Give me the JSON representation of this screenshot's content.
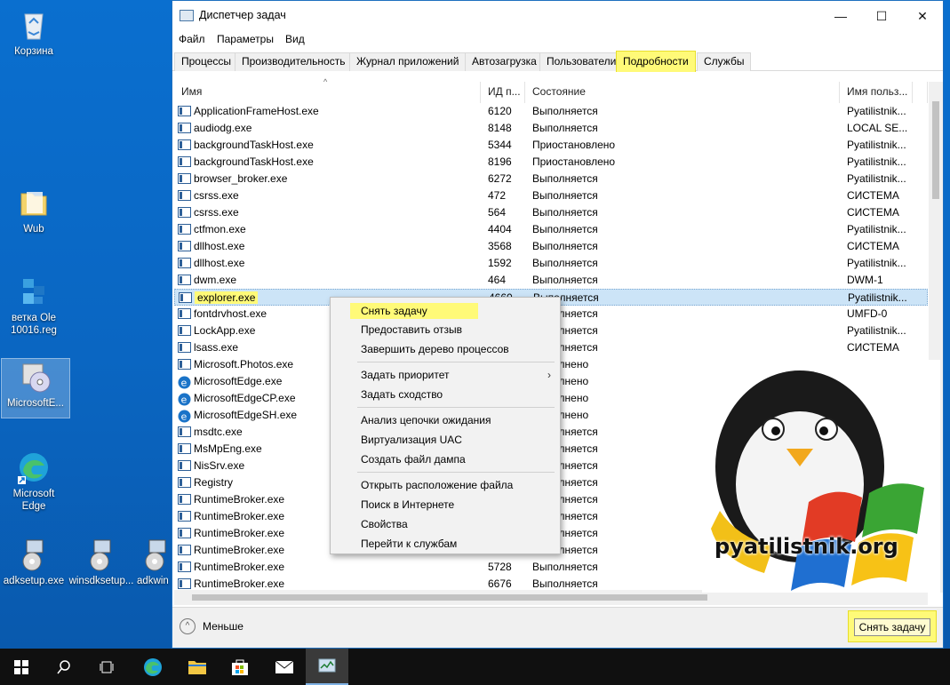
{
  "desktop": {
    "icons": [
      {
        "label": "Корзина"
      },
      {
        "label": "Wub"
      },
      {
        "label": "ветка Ole 10016.reg"
      },
      {
        "label": "MicrosoftE..."
      },
      {
        "label": "Microsoft Edge"
      },
      {
        "label": "adksetup.exe"
      },
      {
        "label": "winsdksetup..."
      },
      {
        "label": "adkwin"
      }
    ]
  },
  "window": {
    "title": "Диспетчер задач",
    "menu": [
      "Файл",
      "Параметры",
      "Вид"
    ],
    "tabs": [
      "Процессы",
      "Производительность",
      "Журнал приложений",
      "Автозагрузка",
      "Пользователи",
      "Подробности",
      "Службы"
    ],
    "active_tab": "Подробности",
    "columns": [
      "Имя",
      "ИД п...",
      "Состояние",
      "Имя польз..."
    ],
    "rows": [
      {
        "name": "ApplicationFrameHost.exe",
        "pid": "6120",
        "state": "Выполняется",
        "user": "Pyatilistnik..."
      },
      {
        "name": "audiodg.exe",
        "pid": "8148",
        "state": "Выполняется",
        "user": "LOCAL SE..."
      },
      {
        "name": "backgroundTaskHost.exe",
        "pid": "5344",
        "state": "Приостановлено",
        "user": "Pyatilistnik..."
      },
      {
        "name": "backgroundTaskHost.exe",
        "pid": "8196",
        "state": "Приостановлено",
        "user": "Pyatilistnik..."
      },
      {
        "name": "browser_broker.exe",
        "pid": "6272",
        "state": "Выполняется",
        "user": "Pyatilistnik..."
      },
      {
        "name": "csrss.exe",
        "pid": "472",
        "state": "Выполняется",
        "user": "СИСТЕМА"
      },
      {
        "name": "csrss.exe",
        "pid": "564",
        "state": "Выполняется",
        "user": "СИСТЕМА"
      },
      {
        "name": "ctfmon.exe",
        "pid": "4404",
        "state": "Выполняется",
        "user": "Pyatilistnik..."
      },
      {
        "name": "dllhost.exe",
        "pid": "3568",
        "state": "Выполняется",
        "user": "СИСТЕМА"
      },
      {
        "name": "dllhost.exe",
        "pid": "1592",
        "state": "Выполняется",
        "user": "Pyatilistnik..."
      },
      {
        "name": "dwm.exe",
        "pid": "464",
        "state": "Выполняется",
        "user": "DWM-1"
      },
      {
        "name": "explorer.exe",
        "pid": "4660",
        "state": "Выполняется",
        "user": "Pyatilistnik..."
      },
      {
        "name": "fontdrvhost.exe",
        "pid": "",
        "state": "Выполняется",
        "user": "UMFD-0"
      },
      {
        "name": "LockApp.exe",
        "pid": "",
        "state": "Выполняется",
        "user": "Pyatilistnik..."
      },
      {
        "name": "lsass.exe",
        "pid": "",
        "state": "Выполняется",
        "user": "СИСТЕМА"
      },
      {
        "name": "Microsoft.Photos.exe",
        "pid": "",
        "state": "Выполнено",
        "user": ""
      },
      {
        "name": "MicrosoftEdge.exe",
        "pid": "",
        "state": "Выполнено",
        "user": ""
      },
      {
        "name": "MicrosoftEdgeCP.exe",
        "pid": "",
        "state": "Выполнено",
        "user": ""
      },
      {
        "name": "MicrosoftEdgeSH.exe",
        "pid": "",
        "state": "Выполнено",
        "user": ""
      },
      {
        "name": "msdtc.exe",
        "pid": "",
        "state": "Выполняется",
        "user": ""
      },
      {
        "name": "MsMpEng.exe",
        "pid": "",
        "state": "Выполняется",
        "user": ""
      },
      {
        "name": "NisSrv.exe",
        "pid": "",
        "state": "Выполняется",
        "user": ""
      },
      {
        "name": "Registry",
        "pid": "",
        "state": "Выполняется",
        "user": ""
      },
      {
        "name": "RuntimeBroker.exe",
        "pid": "",
        "state": "Выполняется",
        "user": ""
      },
      {
        "name": "RuntimeBroker.exe",
        "pid": "",
        "state": "Выполняется",
        "user": ""
      },
      {
        "name": "RuntimeBroker.exe",
        "pid": "",
        "state": "Выполняется",
        "user": ""
      },
      {
        "name": "RuntimeBroker.exe",
        "pid": "",
        "state": "Выполняется",
        "user": ""
      },
      {
        "name": "RuntimeBroker.exe",
        "pid": "5728",
        "state": "Выполняется",
        "user": ""
      },
      {
        "name": "RuntimeBroker.exe",
        "pid": "6676",
        "state": "Выполняется",
        "user": ""
      }
    ],
    "footer": {
      "less_label": "Меньше",
      "end_task_button": "Снять задачу"
    }
  },
  "context_menu": {
    "items": [
      "Снять задачу",
      "Предоставить отзыв",
      "Завершить дерево процессов",
      "Задать приоритет",
      "Задать сходство",
      "Анализ цепочки ожидания",
      "Виртуализация UAC",
      "Создать файл дампа",
      "Открыть расположение файла",
      "Поиск в Интернете",
      "Свойства",
      "Перейти к службам"
    ]
  },
  "watermark": {
    "text": "pyatilistnik.org"
  },
  "colors": {
    "highlight": "#fffa78",
    "selection": "#cce4f7",
    "desktop": "#0a6fcf"
  }
}
